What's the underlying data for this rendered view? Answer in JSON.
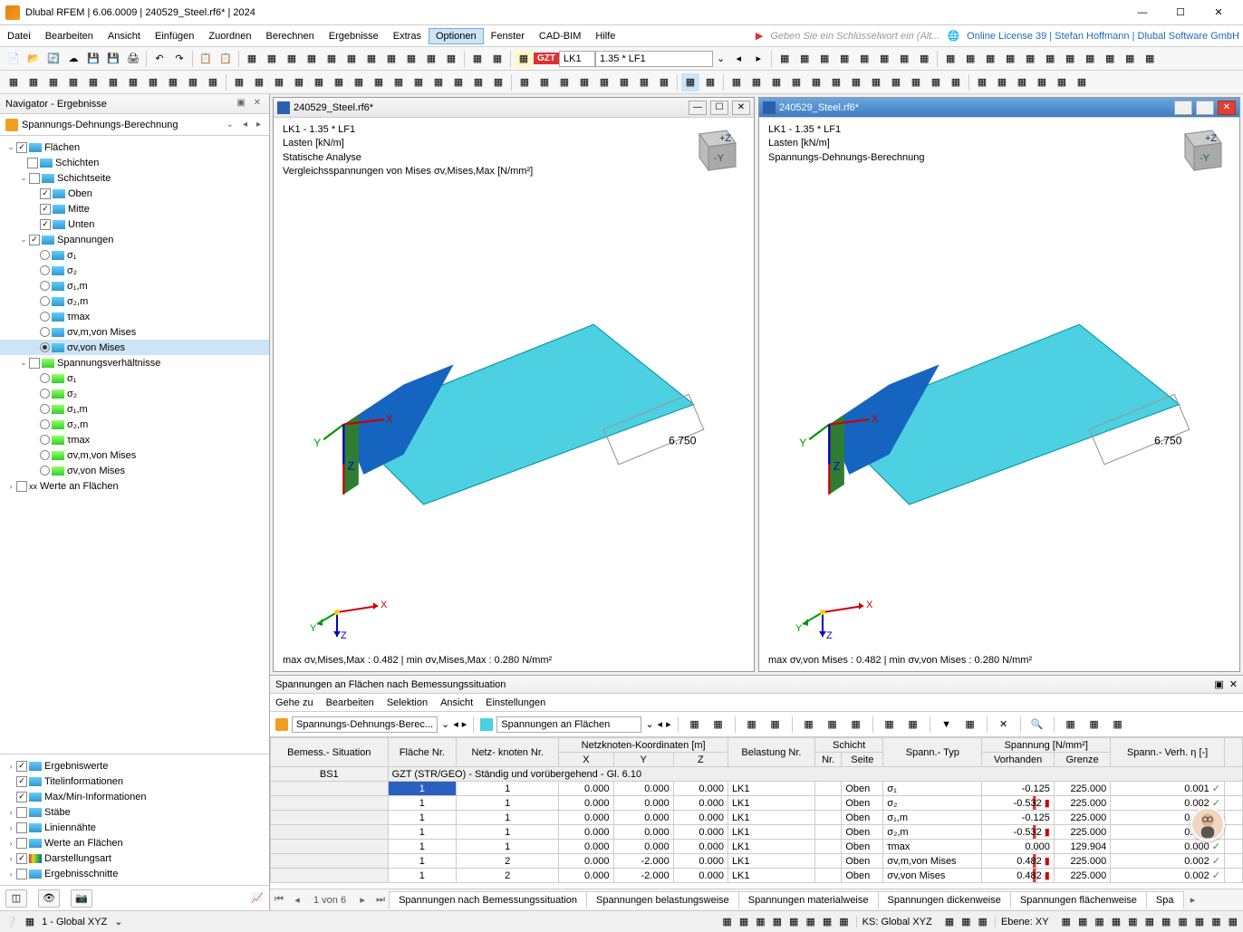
{
  "titlebar": {
    "app": "Dlubal RFEM",
    "version": "6.06.0009",
    "file": "240529_Steel.rf6*",
    "year": "2024"
  },
  "menus": [
    "Datei",
    "Bearbeiten",
    "Ansicht",
    "Einfügen",
    "Zuordnen",
    "Berechnen",
    "Ergebnisse",
    "Extras",
    "Optionen",
    "Fenster",
    "CAD-BIM",
    "Hilfe"
  ],
  "menu_active": "Optionen",
  "search_placeholder": "Geben Sie ein Schlüsselwort ein (Alt...",
  "license_info": "Online License 39 | Stefan Hoffmann | Dlubal Software GmbH",
  "toolbar1": {
    "gzt": "GZT",
    "lk": "LK1",
    "factor": "1.35 * LF1"
  },
  "navigator": {
    "title": "Navigator - Ergebnisse",
    "breadcrumb": "Spannungs-Dehnungs-Berechnung",
    "tree": {
      "flaechen": "Flächen",
      "schichten": "Schichten",
      "schichtseite": "Schichtseite",
      "oben": "Oben",
      "mitte": "Mitte",
      "unten": "Unten",
      "spannungen": "Spannungen",
      "s1": "σ₁",
      "s2": "σ₂",
      "s1m": "σ₁,m",
      "s2m": "σ₂,m",
      "tmax": "τmax",
      "svmvm": "σv,m,von Mises",
      "svvm": "σv,von Mises",
      "spannungsverh": "Spannungsverhältnisse",
      "werte_flaechen": "Werte an Flächen"
    },
    "lower": {
      "ergebniswerte": "Ergebniswerte",
      "titelinfo": "Titelinformationen",
      "maxmin": "Max/Min-Informationen",
      "staebe": "Stäbe",
      "liniennaehte": "Liniennähte",
      "werte_flaechen": "Werte an Flächen",
      "darstellungsart": "Darstellungsart",
      "ergebnisschnitte": "Ergebnisschnitte"
    }
  },
  "view1": {
    "title": "240529_Steel.rf6*",
    "line1": "LK1 - 1.35 * LF1",
    "line2": "Lasten [kN/m]",
    "line3": "Statische Analyse",
    "line4": "Vergleichsspannungen von Mises σv,Mises,Max [N/mm²]",
    "load": "6.750",
    "foot": "max σv,Mises,Max : 0.482 | min σv,Mises,Max : 0.280 N/mm²"
  },
  "view2": {
    "title": "240529_Steel.rf6*",
    "line1": "LK1 - 1.35 * LF1",
    "line2": "Lasten [kN/m]",
    "line3": "Spannungs-Dehnungs-Berechnung",
    "load": "6.750",
    "foot": "max σv,von Mises : 0.482 | min σv,von Mises : 0.280 N/mm²"
  },
  "tpanel": {
    "title": "Spannungen an Flächen nach Bemessungssituation",
    "menus": [
      "Gehe zu",
      "Bearbeiten",
      "Selektion",
      "Ansicht",
      "Einstellungen"
    ],
    "combo1": "Spannungs-Dehnungs-Berec...",
    "combo2": "Spannungen an Flächen",
    "headers": {
      "bemess": "Bemess.-\nSituation",
      "flaeche": "Fläche\nNr.",
      "netz": "Netz-\nknoten Nr.",
      "koord": "Netzknoten-Koordinaten [m]",
      "x": "X",
      "y": "Y",
      "z": "Z",
      "belastung": "Belastung\nNr.",
      "schicht": "Schicht",
      "schicht_nr": "Nr.",
      "schicht_seite": "Seite",
      "spann_typ": "Spann.-\nTyp",
      "spannung": "Spannung [N/mm²]",
      "vorhanden": "Vorhanden",
      "grenze": "Grenze",
      "verh": "Spann.-\nVerh. η [-]"
    },
    "bs1": "BS1",
    "group_row": "GZT (STR/GEO) - Ständig und vorübergehend - Gl. 6.10",
    "rows": [
      {
        "fl": "1",
        "nk": "1",
        "x": "0.000",
        "y": "0.000",
        "z": "0.000",
        "bel": "LK1",
        "sn": "",
        "ss": "Oben",
        "typ": "σ₁",
        "vor": "-0.125",
        "gr": "225.000",
        "vh": "0.001"
      },
      {
        "fl": "1",
        "nk": "1",
        "x": "0.000",
        "y": "0.000",
        "z": "0.000",
        "bel": "LK1",
        "sn": "",
        "ss": "Oben",
        "typ": "σ₂",
        "vor": "-0.532",
        "gr": "225.000",
        "vh": "0.002"
      },
      {
        "fl": "1",
        "nk": "1",
        "x": "0.000",
        "y": "0.000",
        "z": "0.000",
        "bel": "LK1",
        "sn": "",
        "ss": "Oben",
        "typ": "σ₁,m",
        "vor": "-0.125",
        "gr": "225.000",
        "vh": "0.001"
      },
      {
        "fl": "1",
        "nk": "1",
        "x": "0.000",
        "y": "0.000",
        "z": "0.000",
        "bel": "LK1",
        "sn": "",
        "ss": "Oben",
        "typ": "σ₂,m",
        "vor": "-0.532",
        "gr": "225.000",
        "vh": "0.002"
      },
      {
        "fl": "1",
        "nk": "1",
        "x": "0.000",
        "y": "0.000",
        "z": "0.000",
        "bel": "LK1",
        "sn": "",
        "ss": "Oben",
        "typ": "τmax",
        "vor": "0.000",
        "gr": "129.904",
        "vh": "0.000"
      },
      {
        "fl": "1",
        "nk": "2",
        "x": "0.000",
        "y": "-2.000",
        "z": "0.000",
        "bel": "LK1",
        "sn": "",
        "ss": "Oben",
        "typ": "σv,m,von Mises",
        "vor": "0.482",
        "gr": "225.000",
        "vh": "0.002"
      },
      {
        "fl": "1",
        "nk": "2",
        "x": "0.000",
        "y": "-2.000",
        "z": "0.000",
        "bel": "LK1",
        "sn": "",
        "ss": "Oben",
        "typ": "σv,von Mises",
        "vor": "0.482",
        "gr": "225.000",
        "vh": "0.002"
      }
    ],
    "page": "1 von 6",
    "tabs": [
      "Spannungen nach Bemessungssituation",
      "Spannungen belastungsweise",
      "Spannungen materialweise",
      "Spannungen dickenweise",
      "Spannungen flächenweise",
      "Spa"
    ]
  },
  "status": {
    "cs": "1 - Global XYZ",
    "ks": "KS: Global XYZ",
    "ebene": "Ebene: XY"
  }
}
